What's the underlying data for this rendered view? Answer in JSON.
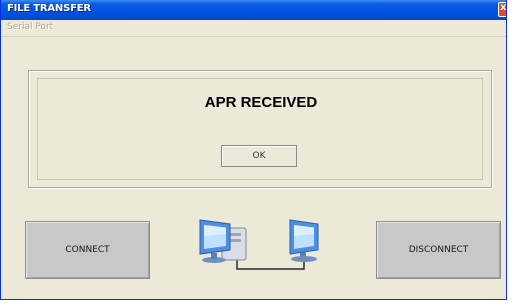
{
  "window": {
    "title": "FILE TRANSFER",
    "close_glyph": "x"
  },
  "menu": {
    "items": [
      {
        "label": "Serial Port",
        "enabled": false
      }
    ]
  },
  "status_panel": {
    "message": "APR RECEIVED",
    "ok_label": "OK"
  },
  "actions": {
    "connect_label": "CONNECT",
    "disconnect_label": "DISCONNECT"
  },
  "graphic": {
    "icon": "network-computers-icon",
    "colors": {
      "monitor": "#4f8fe0",
      "screen": "#bfe0ff",
      "cable": "#2b2b2b"
    }
  },
  "colors": {
    "titlebar": "#0054e3",
    "window_bg": "#ece9d8",
    "button_bg": "#c8c8c8",
    "close": "#e0482a"
  }
}
